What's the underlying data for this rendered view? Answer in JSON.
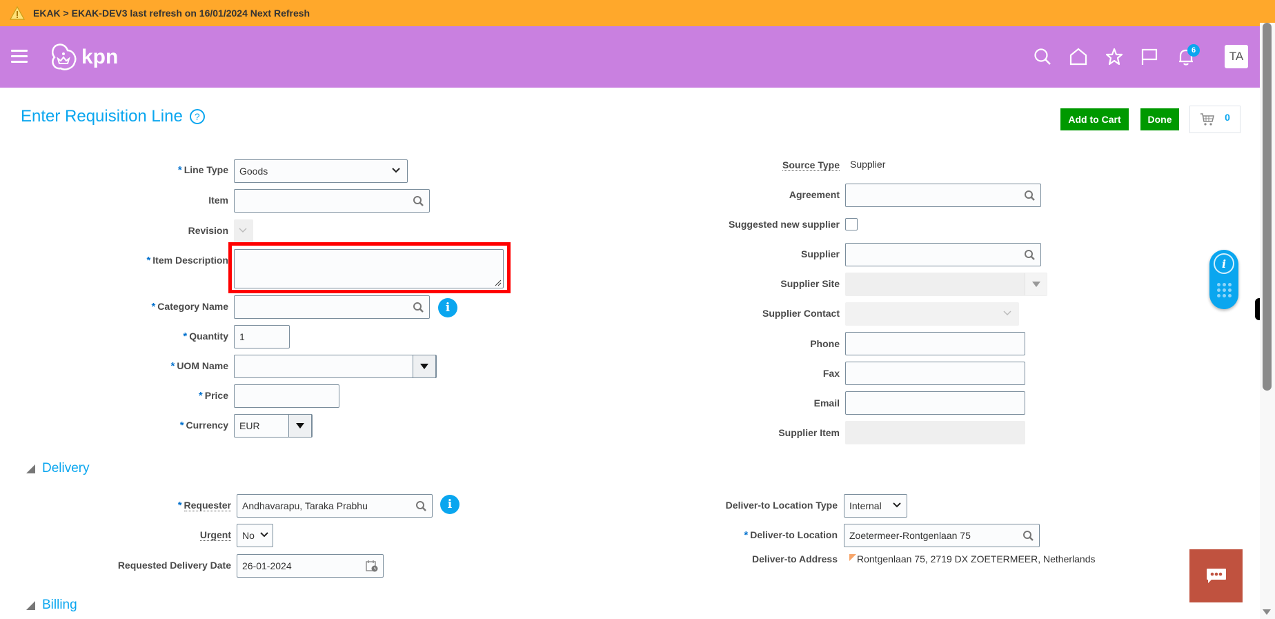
{
  "banner": {
    "text": "EKAK > EKAK-DEV3 last refresh on 16/01/2024 Next Refresh",
    "icon": "warning-icon"
  },
  "header": {
    "logo_text": "kpn",
    "notifications_count": "6",
    "avatar_initials": "TA",
    "icons": [
      "search-icon",
      "home-icon",
      "star-icon",
      "flag-icon",
      "bell-icon"
    ]
  },
  "page": {
    "title": "Enter Requisition Line",
    "help_glyph": "?",
    "add_to_cart_label": "Add to Cart",
    "done_label": "Done",
    "cart_count": "0"
  },
  "left_form": {
    "line_type": {
      "label": "Line Type",
      "value": "Goods",
      "required": true
    },
    "item": {
      "label": "Item",
      "value": ""
    },
    "revision": {
      "label": "Revision",
      "value": ""
    },
    "item_description": {
      "label": "Item Description",
      "value": "",
      "required": true
    },
    "category_name": {
      "label": "Category Name",
      "value": "",
      "required": true
    },
    "quantity": {
      "label": "Quantity",
      "value": "1",
      "required": true
    },
    "uom_name": {
      "label": "UOM Name",
      "value": "",
      "required": true
    },
    "price": {
      "label": "Price",
      "value": "",
      "required": true
    },
    "currency": {
      "label": "Currency",
      "value": "EUR",
      "required": true
    }
  },
  "right_form": {
    "source_type": {
      "label": "Source Type",
      "value": "Supplier"
    },
    "agreement": {
      "label": "Agreement",
      "value": ""
    },
    "suggested_new_supplier": {
      "label": "Suggested new supplier",
      "checked": false
    },
    "supplier": {
      "label": "Supplier",
      "value": ""
    },
    "supplier_site": {
      "label": "Supplier Site",
      "value": ""
    },
    "supplier_contact": {
      "label": "Supplier Contact",
      "value": ""
    },
    "phone": {
      "label": "Phone",
      "value": ""
    },
    "fax": {
      "label": "Fax",
      "value": ""
    },
    "email": {
      "label": "Email",
      "value": ""
    },
    "supplier_item": {
      "label": "Supplier Item",
      "value": ""
    }
  },
  "delivery": {
    "section_title": "Delivery",
    "requester": {
      "label": "Requester",
      "value": "Andhavarapu, Taraka Prabhu",
      "required": true
    },
    "urgent": {
      "label": "Urgent",
      "value": "No"
    },
    "requested_delivery_date": {
      "label": "Requested Delivery Date",
      "value": "26-01-2024"
    },
    "deliver_to_location_type": {
      "label": "Deliver-to Location Type",
      "value": "Internal"
    },
    "deliver_to_location": {
      "label": "Deliver-to Location",
      "value": "Zoetermeer-Rontgenlaan 75",
      "required": true
    },
    "deliver_to_address": {
      "label": "Deliver-to Address",
      "value": "Rontgenlaan 75, 2719 DX ZOETERMEER, Netherlands"
    }
  },
  "billing": {
    "section_title": "Billing"
  },
  "required_marker": "*",
  "info_glyph": "i"
}
